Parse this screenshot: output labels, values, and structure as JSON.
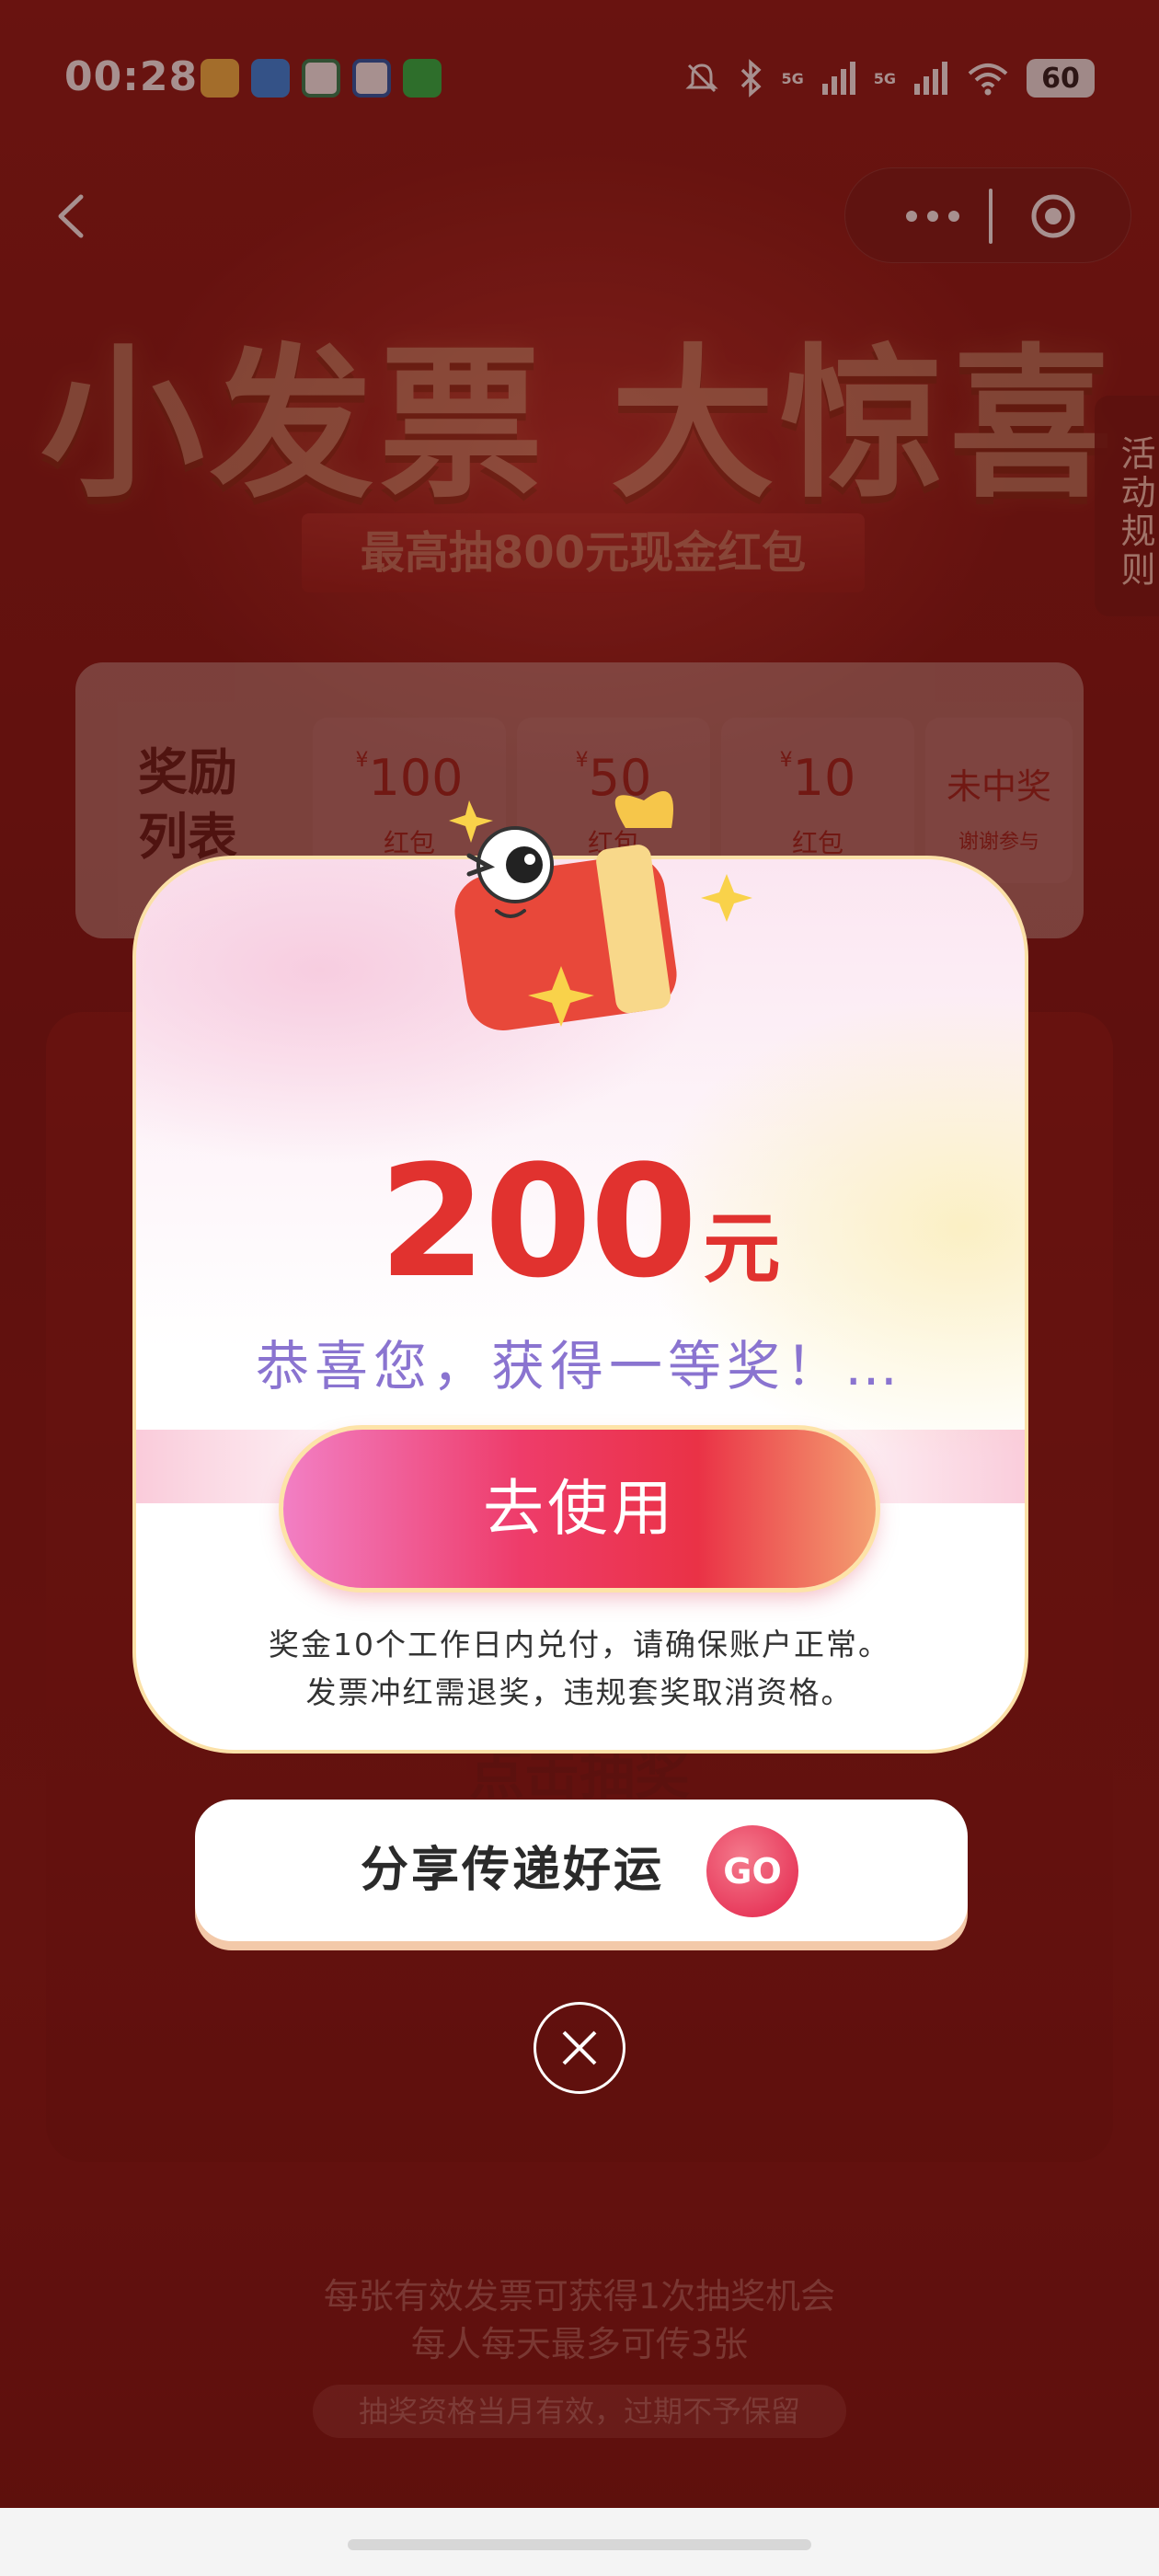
{
  "status_bar": {
    "time": "00:28",
    "network_1": "5G",
    "network_2": "5G",
    "battery": "60"
  },
  "nav": {
    "back_icon": "chevron-left-icon",
    "more_icon": "more-dots-icon",
    "close_icon": "close-circle-icon"
  },
  "banner": {
    "title": "小发票 大惊喜",
    "subtitle": "最高抽800元现金红包",
    "rules_tab": "活动规则"
  },
  "rewards": {
    "title": "奖励列表",
    "items": [
      {
        "currency": "¥",
        "amount": "100",
        "label": "红包"
      },
      {
        "currency": "¥",
        "amount": "50",
        "label": "红包"
      },
      {
        "currency": "¥",
        "amount": "10",
        "label": "红包"
      },
      {
        "currency": "",
        "amount": "未中奖",
        "label": "谢谢参与"
      }
    ]
  },
  "machine": {
    "draw_label": "点击抽奖"
  },
  "modal": {
    "amount": "200",
    "unit": "元",
    "congrats": "恭喜您，获得一等奖！…",
    "use_button": "去使用",
    "notice_line1": "奖金10个工作日内兑付，请确保账户正常。",
    "notice_line2": "发票冲红需退奖，违规套奖取消资格。"
  },
  "share": {
    "label": "分享传递好运",
    "go_button": "GO"
  },
  "footer": {
    "line1": "每张有效发票可获得1次抽奖机会",
    "line2": "每人每天最多可传3张",
    "line3": "抽奖资格当月有效，过期不予保留"
  },
  "colors": {
    "prize_red": "#e1322f",
    "congrats_purple": "#8a74d0",
    "button_pink": "#ee3c6a",
    "background_red": "#7a1512"
  }
}
